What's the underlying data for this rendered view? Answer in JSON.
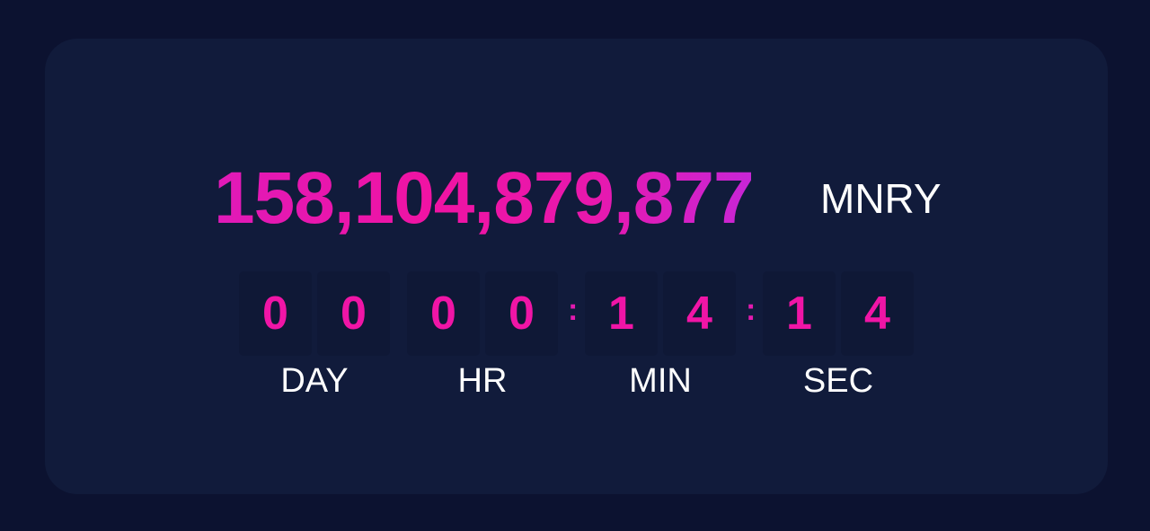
{
  "balance": {
    "amount": "158,104,879,877",
    "unit": "MNRY"
  },
  "countdown": {
    "day": [
      "0",
      "0"
    ],
    "hr": [
      "0",
      "0"
    ],
    "min": [
      "1",
      "4"
    ],
    "sec": [
      "1",
      "4"
    ],
    "separator": ":",
    "labels": {
      "day": "DAY",
      "hr": "HR",
      "min": "MIN",
      "sec": "SEC"
    }
  },
  "colors": {
    "page_background": "#0c1230",
    "card_background": "#111b3b",
    "digit_tile": "#0f1836",
    "accent_pink": "#f015a6",
    "accent_purple": "#c726d6",
    "label_text": "#ffffff"
  }
}
